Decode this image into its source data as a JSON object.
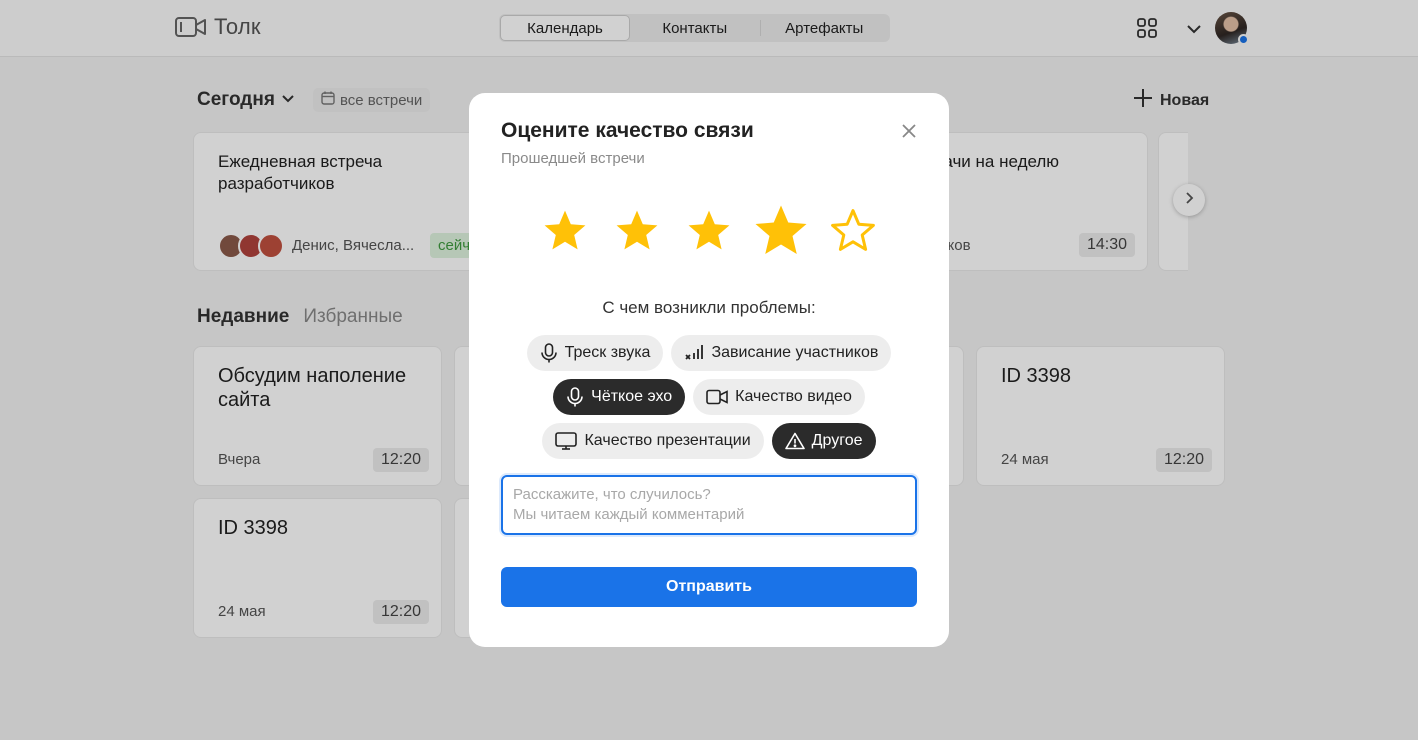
{
  "header": {
    "brand": "Толк",
    "tabs": [
      {
        "label": "Календарь",
        "active": true
      },
      {
        "label": "Контакты",
        "active": false
      },
      {
        "label": "Артефакты",
        "active": false
      }
    ],
    "icons": [
      "video-camera-icon",
      "apps-grid-icon",
      "chevron-down-icon",
      "avatar"
    ]
  },
  "today": {
    "title": "Сегодня",
    "all_meetings": "все встречи",
    "new_label": "Новая",
    "cards": [
      {
        "title": "Ежедневная встреча разработчиков",
        "participants": "Денис, Вячесла...",
        "badge": "сейч"
      },
      {
        "title": "адачи на неделю",
        "participants": "тников",
        "time": "14:30"
      }
    ]
  },
  "recent": {
    "tabs": [
      "Недавние",
      "Избранные"
    ],
    "cards": [
      {
        "title": "Обсудим наполение сайта",
        "date": "Вчера",
        "time": "12:20"
      },
      {
        "title": "ID 3398",
        "date": "24 мая",
        "time": "12:20"
      },
      {
        "title": "ID 3398",
        "date": "24 мая",
        "time": "12:20"
      }
    ]
  },
  "modal": {
    "title": "Оцените качество связи",
    "subtitle": "Прошедшей встречи",
    "rating": 4,
    "max_rating": 5,
    "issues_question": "С чем возникли проблемы:",
    "issues": [
      {
        "label": "Треск звука",
        "icon": "microphone-icon",
        "selected": false
      },
      {
        "label": "Зависание участников",
        "icon": "signal-bars-icon",
        "selected": false
      },
      {
        "label": "Чёткое эхо",
        "icon": "microphone-icon",
        "selected": true
      },
      {
        "label": "Качество видео",
        "icon": "video-camera-icon",
        "selected": false
      },
      {
        "label": "Качество презентации",
        "icon": "monitor-icon",
        "selected": false
      },
      {
        "label": "Другое",
        "icon": "warning-icon",
        "selected": true
      }
    ],
    "comment_placeholder": "Расскажите, что случилось?\nМы читаем каждый комментарий",
    "submit_label": "Отправить",
    "colors": {
      "accent": "#1a73e8",
      "star": "#ffc107",
      "chip_selected": "#2b2b2b"
    }
  }
}
